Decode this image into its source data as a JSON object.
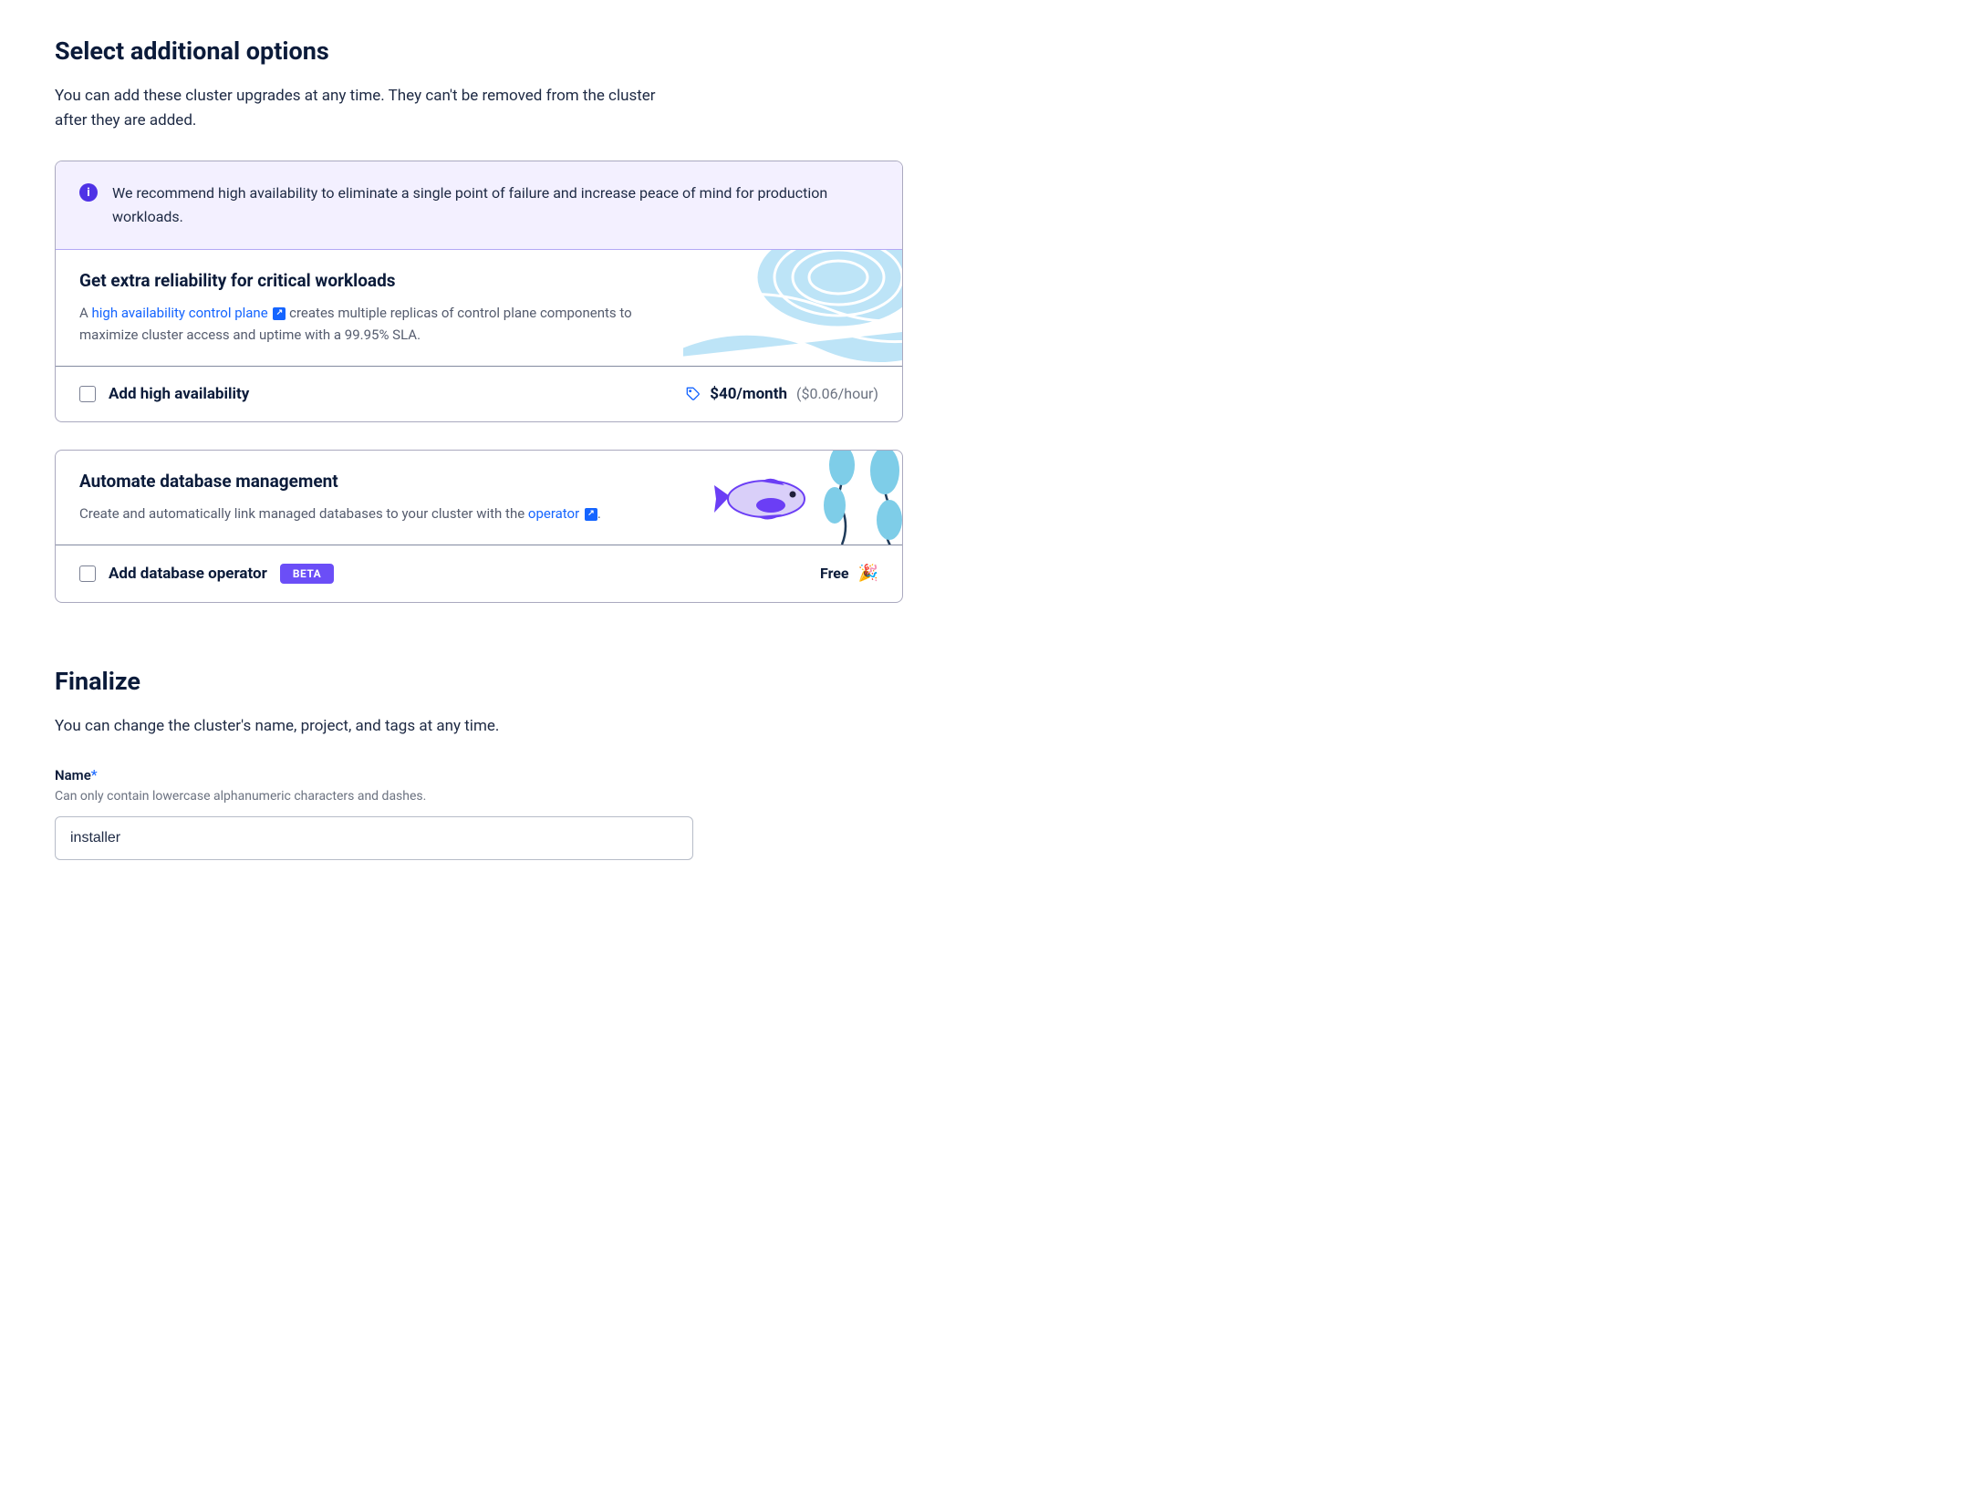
{
  "section1": {
    "heading": "Select additional options",
    "subtitle": "You can add these cluster upgrades at any time. They can't be removed from the cluster after they are added.",
    "info_text": "We recommend high availability to eliminate a single point of failure and increase peace of mind for production workloads."
  },
  "ha_card": {
    "title": "Get extra reliability for critical workloads",
    "desc_a": "A ",
    "desc_link": "high availability control plane",
    "desc_b": " creates multiple replicas of control plane components to maximize cluster access and uptime with a 99.95% SLA.",
    "option_label": "Add high availability",
    "price_main": "$40/month",
    "price_sub": "($0.06/hour)"
  },
  "db_card": {
    "title": "Automate database management",
    "desc_a": "Create and automatically link managed databases to your cluster with the ",
    "desc_link": "operator",
    "desc_b": ".",
    "option_label": "Add database operator",
    "badge": "BETA",
    "free_label": "Free"
  },
  "finalize": {
    "heading": "Finalize",
    "subtitle": "You can change the cluster's name, project, and tags at any time.",
    "name_label": "Name",
    "name_hint": "Can only contain lowercase alphanumeric characters and dashes.",
    "name_value": "installer"
  }
}
